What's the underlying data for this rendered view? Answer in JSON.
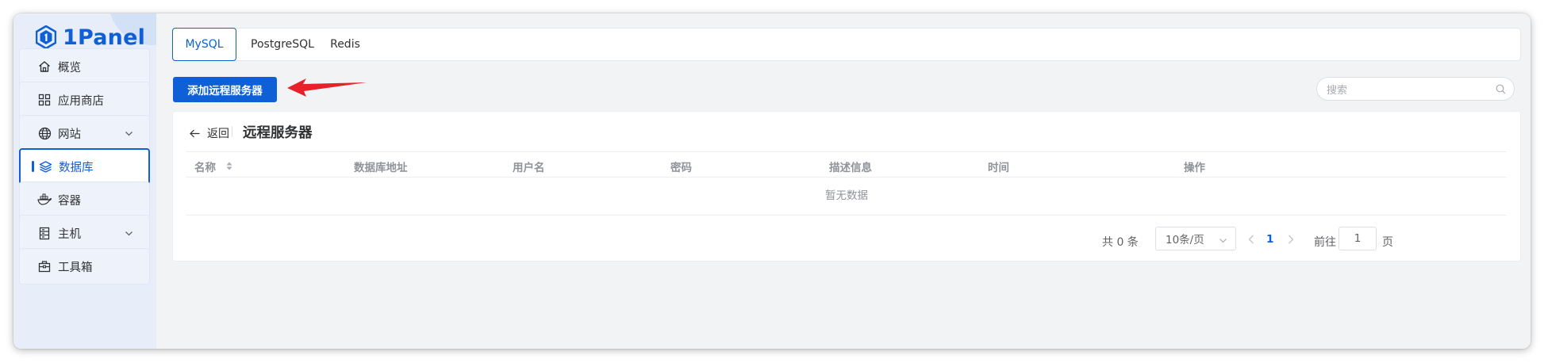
{
  "app": {
    "name": "1Panel"
  },
  "sidebar": {
    "items": [
      {
        "label": "概览",
        "icon": "home-icon"
      },
      {
        "label": "应用商店",
        "icon": "grid-icon"
      },
      {
        "label": "网站",
        "icon": "globe-icon",
        "expandable": true
      },
      {
        "label": "数据库",
        "icon": "layers-icon",
        "active": true
      },
      {
        "label": "容器",
        "icon": "docker-icon"
      },
      {
        "label": "主机",
        "icon": "server-icon",
        "expandable": true
      },
      {
        "label": "工具箱",
        "icon": "toolbox-icon"
      }
    ]
  },
  "tabs": [
    {
      "label": "MySQL",
      "active": true
    },
    {
      "label": "PostgreSQL"
    },
    {
      "label": "Redis"
    }
  ],
  "toolbar": {
    "add_remote_label": "添加远程服务器",
    "search_placeholder": "搜索"
  },
  "page": {
    "back_label": "返回",
    "title": "远程服务器"
  },
  "table": {
    "columns": [
      "名称",
      "数据库地址",
      "用户名",
      "密码",
      "描述信息",
      "时间",
      "操作"
    ],
    "rows": [],
    "empty_text": "暂无数据"
  },
  "pagination": {
    "total_label": "共 0 条",
    "page_size_label": "10条/页",
    "current_page": "1",
    "goto_label": "前往",
    "goto_value": "1",
    "goto_suffix": "页"
  },
  "colors": {
    "accent": "#0f5fd7",
    "annotation_arrow": "#e8202a"
  }
}
